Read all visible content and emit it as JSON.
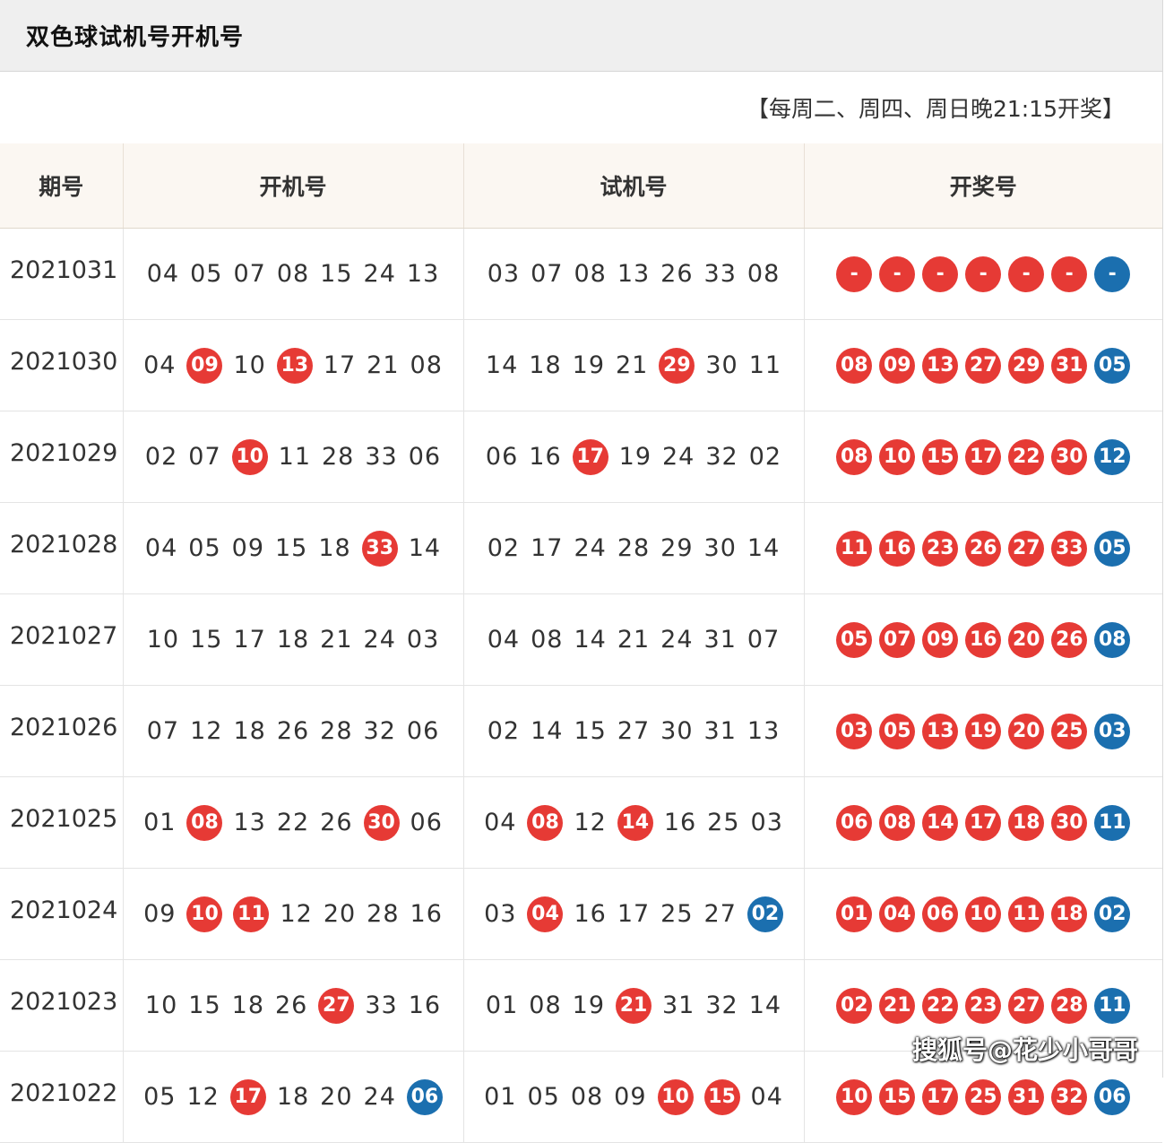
{
  "title": "双色球试机号开机号",
  "schedule": "【每周二、周四、周日晚21:15开奖】",
  "headers": [
    "期号",
    "开机号",
    "试机号",
    "开奖号"
  ],
  "colors": {
    "red_ball": "#e63a35",
    "blue_ball": "#1b6faf"
  },
  "rows": [
    {
      "issue": "2021031",
      "open": [
        {
          "n": "04"
        },
        {
          "n": "05"
        },
        {
          "n": "07"
        },
        {
          "n": "08"
        },
        {
          "n": "15"
        },
        {
          "n": "24"
        },
        {
          "n": "13"
        }
      ],
      "trial": [
        {
          "n": "03"
        },
        {
          "n": "07"
        },
        {
          "n": "08"
        },
        {
          "n": "13"
        },
        {
          "n": "26"
        },
        {
          "n": "33"
        },
        {
          "n": "08"
        }
      ],
      "draw": {
        "red": [
          "-",
          "-",
          "-",
          "-",
          "-",
          "-"
        ],
        "blue": "-"
      }
    },
    {
      "issue": "2021030",
      "open": [
        {
          "n": "04"
        },
        {
          "n": "09",
          "h": "red"
        },
        {
          "n": "10"
        },
        {
          "n": "13",
          "h": "red"
        },
        {
          "n": "17"
        },
        {
          "n": "21"
        },
        {
          "n": "08"
        }
      ],
      "trial": [
        {
          "n": "14"
        },
        {
          "n": "18"
        },
        {
          "n": "19"
        },
        {
          "n": "21"
        },
        {
          "n": "29",
          "h": "red"
        },
        {
          "n": "30"
        },
        {
          "n": "11"
        }
      ],
      "draw": {
        "red": [
          "08",
          "09",
          "13",
          "27",
          "29",
          "31"
        ],
        "blue": "05"
      }
    },
    {
      "issue": "2021029",
      "open": [
        {
          "n": "02"
        },
        {
          "n": "07"
        },
        {
          "n": "10",
          "h": "red"
        },
        {
          "n": "11"
        },
        {
          "n": "28"
        },
        {
          "n": "33"
        },
        {
          "n": "06"
        }
      ],
      "trial": [
        {
          "n": "06"
        },
        {
          "n": "16"
        },
        {
          "n": "17",
          "h": "red"
        },
        {
          "n": "19"
        },
        {
          "n": "24"
        },
        {
          "n": "32"
        },
        {
          "n": "02"
        }
      ],
      "draw": {
        "red": [
          "08",
          "10",
          "15",
          "17",
          "22",
          "30"
        ],
        "blue": "12"
      }
    },
    {
      "issue": "2021028",
      "open": [
        {
          "n": "04"
        },
        {
          "n": "05"
        },
        {
          "n": "09"
        },
        {
          "n": "15"
        },
        {
          "n": "18"
        },
        {
          "n": "33",
          "h": "red"
        },
        {
          "n": "14"
        }
      ],
      "trial": [
        {
          "n": "02"
        },
        {
          "n": "17"
        },
        {
          "n": "24"
        },
        {
          "n": "28"
        },
        {
          "n": "29"
        },
        {
          "n": "30"
        },
        {
          "n": "14"
        }
      ],
      "draw": {
        "red": [
          "11",
          "16",
          "23",
          "26",
          "27",
          "33"
        ],
        "blue": "05"
      }
    },
    {
      "issue": "2021027",
      "open": [
        {
          "n": "10"
        },
        {
          "n": "15"
        },
        {
          "n": "17"
        },
        {
          "n": "18"
        },
        {
          "n": "21"
        },
        {
          "n": "24"
        },
        {
          "n": "03"
        }
      ],
      "trial": [
        {
          "n": "04"
        },
        {
          "n": "08"
        },
        {
          "n": "14"
        },
        {
          "n": "21"
        },
        {
          "n": "24"
        },
        {
          "n": "31"
        },
        {
          "n": "07"
        }
      ],
      "draw": {
        "red": [
          "05",
          "07",
          "09",
          "16",
          "20",
          "26"
        ],
        "blue": "08"
      }
    },
    {
      "issue": "2021026",
      "open": [
        {
          "n": "07"
        },
        {
          "n": "12"
        },
        {
          "n": "18"
        },
        {
          "n": "26"
        },
        {
          "n": "28"
        },
        {
          "n": "32"
        },
        {
          "n": "06"
        }
      ],
      "trial": [
        {
          "n": "02"
        },
        {
          "n": "14"
        },
        {
          "n": "15"
        },
        {
          "n": "27"
        },
        {
          "n": "30"
        },
        {
          "n": "31"
        },
        {
          "n": "13"
        }
      ],
      "draw": {
        "red": [
          "03",
          "05",
          "13",
          "19",
          "20",
          "25"
        ],
        "blue": "03"
      }
    },
    {
      "issue": "2021025",
      "open": [
        {
          "n": "01"
        },
        {
          "n": "08",
          "h": "red"
        },
        {
          "n": "13"
        },
        {
          "n": "22"
        },
        {
          "n": "26"
        },
        {
          "n": "30",
          "h": "red"
        },
        {
          "n": "06"
        }
      ],
      "trial": [
        {
          "n": "04"
        },
        {
          "n": "08",
          "h": "red"
        },
        {
          "n": "12"
        },
        {
          "n": "14",
          "h": "red"
        },
        {
          "n": "16"
        },
        {
          "n": "25"
        },
        {
          "n": "03"
        }
      ],
      "draw": {
        "red": [
          "06",
          "08",
          "14",
          "17",
          "18",
          "30"
        ],
        "blue": "11"
      }
    },
    {
      "issue": "2021024",
      "open": [
        {
          "n": "09"
        },
        {
          "n": "10",
          "h": "red"
        },
        {
          "n": "11",
          "h": "red"
        },
        {
          "n": "12"
        },
        {
          "n": "20"
        },
        {
          "n": "28"
        },
        {
          "n": "16"
        }
      ],
      "trial": [
        {
          "n": "03"
        },
        {
          "n": "04",
          "h": "red"
        },
        {
          "n": "16"
        },
        {
          "n": "17"
        },
        {
          "n": "25"
        },
        {
          "n": "27"
        },
        {
          "n": "02",
          "h": "blue"
        }
      ],
      "draw": {
        "red": [
          "01",
          "04",
          "06",
          "10",
          "11",
          "18"
        ],
        "blue": "02"
      }
    },
    {
      "issue": "2021023",
      "open": [
        {
          "n": "10"
        },
        {
          "n": "15"
        },
        {
          "n": "18"
        },
        {
          "n": "26"
        },
        {
          "n": "27",
          "h": "red"
        },
        {
          "n": "33"
        },
        {
          "n": "16"
        }
      ],
      "trial": [
        {
          "n": "01"
        },
        {
          "n": "08"
        },
        {
          "n": "19"
        },
        {
          "n": "21",
          "h": "red"
        },
        {
          "n": "31"
        },
        {
          "n": "32"
        },
        {
          "n": "14"
        }
      ],
      "draw": {
        "red": [
          "02",
          "21",
          "22",
          "23",
          "27",
          "28"
        ],
        "blue": "11"
      }
    },
    {
      "issue": "2021022",
      "open": [
        {
          "n": "05"
        },
        {
          "n": "12"
        },
        {
          "n": "17",
          "h": "red"
        },
        {
          "n": "18"
        },
        {
          "n": "20"
        },
        {
          "n": "24"
        },
        {
          "n": "06",
          "h": "blue"
        }
      ],
      "trial": [
        {
          "n": "01"
        },
        {
          "n": "05"
        },
        {
          "n": "08"
        },
        {
          "n": "09"
        },
        {
          "n": "10",
          "h": "red"
        },
        {
          "n": "15",
          "h": "red"
        },
        {
          "n": "04"
        }
      ],
      "draw": {
        "red": [
          "10",
          "15",
          "17",
          "25",
          "31",
          "32"
        ],
        "blue": "06"
      }
    }
  ],
  "watermark": "搜狐号@花少小哥哥"
}
